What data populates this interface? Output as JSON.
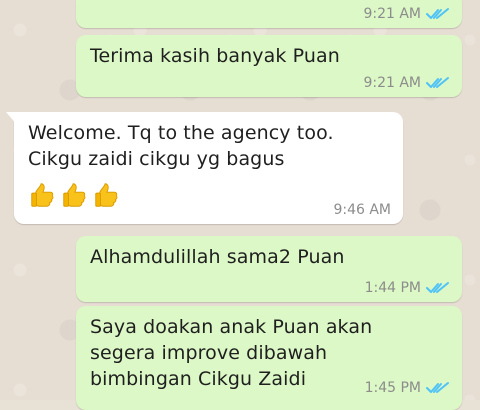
{
  "messages": [
    {
      "direction": "outgoing",
      "text": "",
      "time": "9:21 AM",
      "status": "read"
    },
    {
      "direction": "outgoing",
      "text": "Terima kasih banyak Puan",
      "time": "9:21 AM",
      "status": "read"
    },
    {
      "direction": "incoming",
      "text": "Welcome. Tq to the agency too.\nCikgu zaidi cikgu yg bagus",
      "emoji": [
        "thumbs-up",
        "thumbs-up",
        "thumbs-up"
      ],
      "time": "9:46 AM"
    },
    {
      "direction": "outgoing",
      "text": "Alhamdulillah sama2 Puan",
      "time": "1:44 PM",
      "status": "read"
    },
    {
      "direction": "outgoing",
      "text": "Saya doakan anak Puan akan\nsegera improve dibawah\nbimbingan Cikgu Zaidi",
      "time": "1:45 PM",
      "status": "read"
    }
  ],
  "colors": {
    "outgoing_bubble": "#dcf8c6",
    "incoming_bubble": "#ffffff",
    "read_ticks": "#4fc3f7",
    "timestamp": "#8c8c8c",
    "background": "#e6ded3"
  }
}
